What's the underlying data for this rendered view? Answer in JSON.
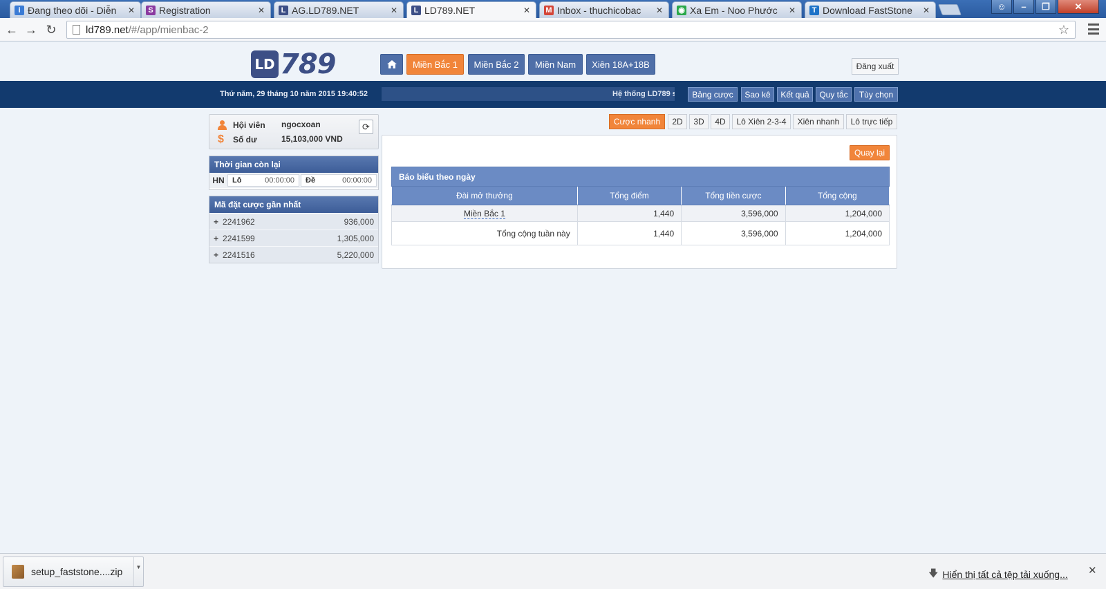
{
  "browser": {
    "tabs": [
      {
        "label": "Đang theo dõi - Diễn",
        "fav_color": "#3a7bd5",
        "fav_glyph": "i"
      },
      {
        "label": "Registration",
        "fav_color": "#8b3aa0",
        "fav_glyph": "S"
      },
      {
        "label": "AG.LD789.NET",
        "fav_color": "#3d4f86",
        "fav_glyph": "L"
      },
      {
        "label": "LD789.NET",
        "fav_color": "#3d4f86",
        "fav_glyph": "L"
      },
      {
        "label": "Inbox - thuchicobac",
        "fav_color": "#d44638",
        "fav_glyph": "M"
      },
      {
        "label": "Xa Em - Noo Phước",
        "fav_color": "#2aa84a",
        "fav_glyph": "◉"
      },
      {
        "label": "Download FastStone",
        "fav_color": "#1e73c8",
        "fav_glyph": "T"
      }
    ],
    "url_host": "ld789.net",
    "url_path": "/#/app/mienbac-2"
  },
  "site": {
    "logo_ld": "LD",
    "logo_num": "789",
    "home_icon": "home-icon",
    "nav": [
      "Miền Bắc 1",
      "Miền Bắc 2",
      "Miền Nam",
      "Xiên 18A+18B"
    ],
    "logout": "Đăng xuất",
    "datetime": "Thứ năm, 29 tháng 10 năm 2015 19:40:52",
    "ticker": "Hệ thống LD789 s",
    "subnav": [
      "Bảng cược",
      "Sao kê",
      "Kết quả",
      "Quy tắc",
      "Tùy chọn"
    ],
    "accent": "#f1853a",
    "primary": "#123a6e"
  },
  "user": {
    "member_label": "Hội viên",
    "member_value": "ngocxoan",
    "balance_label": "Số dư",
    "balance_value": "15,103,000 VND"
  },
  "timer": {
    "title": "Thời gian còn lại",
    "region": "HN",
    "lo_label": "Lô",
    "lo_value": "00:00:00",
    "de_label": "Đề",
    "de_value": "00:00:00"
  },
  "recent_bets": {
    "title": "Mã đặt cược gần nhất",
    "rows": [
      {
        "code": "2241962",
        "amount": "936,000"
      },
      {
        "code": "2241599",
        "amount": "1,305,000"
      },
      {
        "code": "2241516",
        "amount": "5,220,000"
      }
    ]
  },
  "modes": [
    "Cược nhanh",
    "2D",
    "3D",
    "4D",
    "Lô Xiên 2-3-4",
    "Xiên nhanh",
    "Lô trực tiếp"
  ],
  "report": {
    "back_label": "Quay lại",
    "title": "Báo biểu theo ngày",
    "headers": [
      "Đài mở thưởng",
      "Tổng điểm",
      "Tổng tiền cược",
      "Tổng cộng"
    ],
    "rows": [
      {
        "station": "Miền Bắc 1",
        "points": "1,440",
        "stake": "3,596,000",
        "total": "1,204,000"
      },
      {
        "station": "Tổng cộng tuần này",
        "points": "1,440",
        "stake": "3,596,000",
        "total": "1,204,000"
      }
    ]
  },
  "downloads": {
    "file": "setup_faststone....zip",
    "show_all": "Hiển thị tất cả tệp tải xuống..."
  }
}
